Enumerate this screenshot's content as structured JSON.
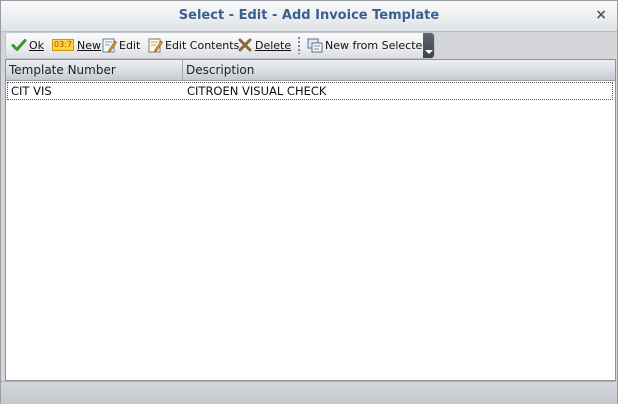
{
  "window": {
    "title": "Select - Edit - Add Invoice Template",
    "close_glyph": "×"
  },
  "toolbar": {
    "ok_label": "Ok",
    "new_label": "New",
    "new_icon_text": "03:7",
    "edit_label": "Edit",
    "edit_contents_label": "Edit Contents",
    "delete_label": "Delete",
    "new_from_selected_label": "New from Selected"
  },
  "grid": {
    "columns": [
      "Template Number",
      "Description"
    ],
    "rows": [
      {
        "template_number": "CIT VIS",
        "description": "CITROEN VISUAL CHECK"
      }
    ]
  },
  "colors": {
    "title_text": "#3b5f8f",
    "ok_check": "#3a9a2e",
    "delete_x": "#8a6a3a"
  },
  "icons": [
    "check-icon",
    "new-icon",
    "edit-icon",
    "edit-contents-icon",
    "delete-icon",
    "new-from-selected-icon",
    "close-icon"
  ]
}
